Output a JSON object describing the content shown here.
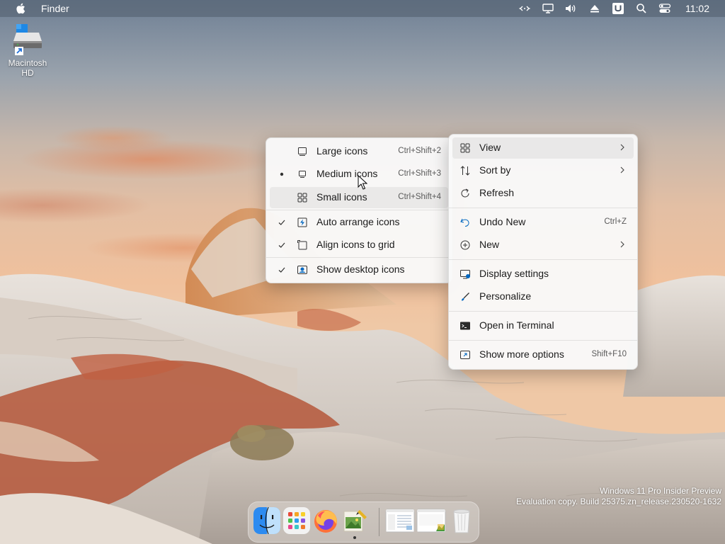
{
  "menubar": {
    "app_name": "Finder",
    "clock": "11:02",
    "icons": [
      "apple-icon",
      "remote-desktop-icon",
      "display-icon",
      "volume-icon",
      "eject-icon",
      "u-icon",
      "search-icon",
      "control-center-icon"
    ]
  },
  "desktop": {
    "icons": [
      {
        "label": "Macintosh HD",
        "icon": "hard-drive-icon"
      }
    ]
  },
  "view_submenu": {
    "items": [
      {
        "label": "Large icons",
        "shortcut": "Ctrl+Shift+2",
        "icon": "large-icons-icon",
        "mark": ""
      },
      {
        "label": "Medium icons",
        "shortcut": "Ctrl+Shift+3",
        "icon": "medium-icons-icon",
        "mark": "bullet"
      },
      {
        "label": "Small icons",
        "shortcut": "Ctrl+Shift+4",
        "icon": "small-icons-icon",
        "mark": ""
      },
      {
        "label": "Auto arrange icons",
        "icon": "auto-arrange-icon",
        "mark": "check"
      },
      {
        "label": "Align icons to grid",
        "icon": "align-grid-icon",
        "mark": "check"
      },
      {
        "label": "Show desktop icons",
        "icon": "show-desktop-icon",
        "mark": "check"
      }
    ]
  },
  "context_menu": {
    "items": [
      {
        "label": "View",
        "icon": "grid-icon",
        "submenu": true
      },
      {
        "label": "Sort by",
        "icon": "sort-icon",
        "submenu": true
      },
      {
        "label": "Refresh",
        "icon": "refresh-icon"
      },
      {
        "label": "Undo New",
        "icon": "undo-icon",
        "shortcut": "Ctrl+Z"
      },
      {
        "label": "New",
        "icon": "new-icon",
        "submenu": true
      },
      {
        "label": "Display settings",
        "icon": "display-settings-icon"
      },
      {
        "label": "Personalize",
        "icon": "brush-icon"
      },
      {
        "label": "Open in Terminal",
        "icon": "terminal-icon"
      },
      {
        "label": "Show more options",
        "icon": "more-options-icon",
        "shortcut": "Shift+F10"
      }
    ]
  },
  "watermark": {
    "line1": "Windows 11 Pro Insider Preview",
    "line2": "Evaluation copy. Build 25375.zn_release.230520-1632"
  },
  "dock": {
    "items": [
      "finder-icon",
      "launchpad-icon",
      "firefox-icon",
      "image-editor-icon",
      "window-thumbnail-icon",
      "window-thumbnail-icon",
      "trash-icon"
    ]
  },
  "colors": {
    "accent": "#0067c0",
    "menu_bg": "#f9f9f9",
    "menubar_bg": "#505c6c"
  }
}
